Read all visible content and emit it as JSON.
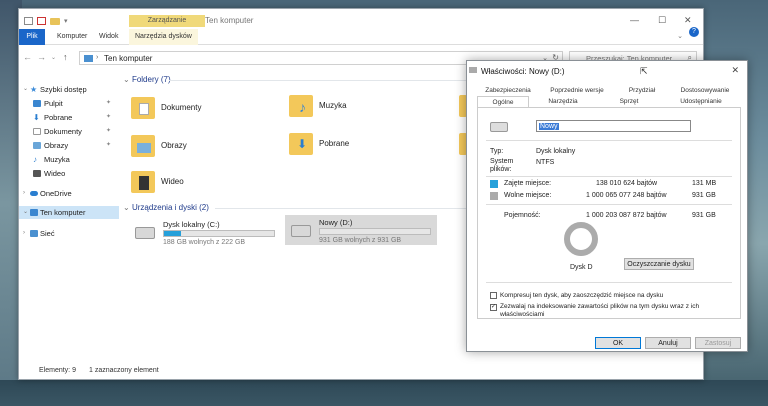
{
  "explorer": {
    "title": "Ten komputer",
    "context_tab": "Zarządzanie",
    "ribbon_tabs": [
      "Plik",
      "Komputer",
      "Widok",
      "Narzędzia dysków"
    ],
    "address": "Ten komputer",
    "search_placeholder": "Przeszukaj: Ten komputer",
    "sidebar": {
      "quick_access": "Szybki dostęp",
      "items": [
        "Pulpit",
        "Pobrane",
        "Dokumenty",
        "Obrazy",
        "Muzyka",
        "Wideo"
      ],
      "onedrive": "OneDrive",
      "this_pc": "Ten komputer",
      "network": "Sieć"
    },
    "folders_header": "Foldery (7)",
    "folders": [
      "Dokumenty",
      "Muzyka",
      "Obrazy",
      "Pobrane",
      "Wideo"
    ],
    "devices_header": "Urządzenia i dyski (2)",
    "drives": [
      {
        "name": "Dysk lokalny (C:)",
        "free": "188 GB wolnych z 222 GB",
        "used_fraction": 0.15
      },
      {
        "name": "Nowy (D:)",
        "free": "931 GB wolnych z 931 GB",
        "used_fraction": 0.0
      }
    ],
    "status": {
      "count": "Elementy: 9",
      "selected": "1 zaznaczony element"
    }
  },
  "props": {
    "title": "Właściwości: Nowy (D:)",
    "tabs_row1": [
      "Zabezpieczenia",
      "Poprzednie wersje",
      "Przydział",
      "Dostosowywanie"
    ],
    "tabs_row2": [
      "Ogólne",
      "Narzędzia",
      "Sprzęt",
      "Udostępnianie"
    ],
    "name_value": "Nowy",
    "type_label": "Typ:",
    "type_value": "Dysk lokalny",
    "fs_label": "System plików:",
    "fs_value": "NTFS",
    "used_label": "Zajęte miejsce:",
    "used_bytes": "138 010 624 bajtów",
    "used_size": "131 MB",
    "free_label": "Wolne miejsce:",
    "free_bytes": "1 000 065 077 248 bajtów",
    "free_size": "931 GB",
    "cap_label": "Pojemność:",
    "cap_bytes": "1 000 203 087 872 bajtów",
    "cap_size": "931 GB",
    "drive_label": "Dysk D",
    "cleanup_button": "Oczyszczanie dysku",
    "compress_label": "Kompresuj ten dysk, aby zaoszczędzić miejsce na dysku",
    "index_label": "Zezwalaj na indeksowanie zawartości plików na tym dysku wraz z ich właściwościami",
    "ok": "OK",
    "cancel": "Anuluj",
    "apply": "Zastosuj",
    "used_color": "#26a0da",
    "free_color": "#ababab"
  }
}
